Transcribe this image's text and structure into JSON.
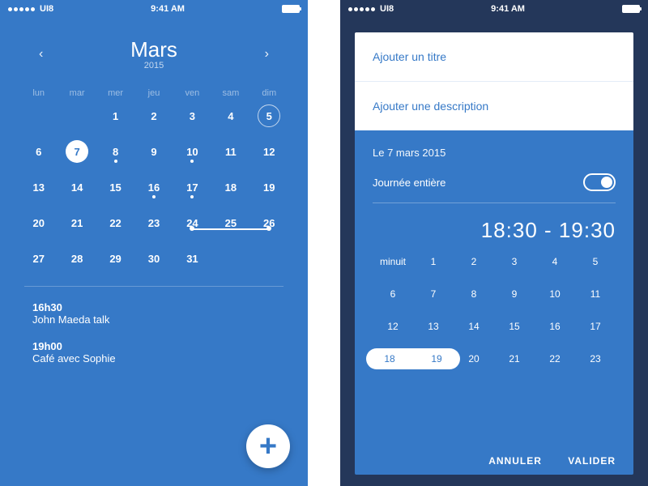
{
  "status": {
    "carrier": "UI8",
    "time": "9:41 AM"
  },
  "left": {
    "month": "Mars",
    "year": "2015",
    "weekdays": [
      "lun",
      "mar",
      "mer",
      "jeu",
      "ven",
      "sam",
      "dim"
    ],
    "days": [
      {
        "n": "",
        "dot": false
      },
      {
        "n": "",
        "dot": false
      },
      {
        "n": "1",
        "dot": false
      },
      {
        "n": "2",
        "dot": false
      },
      {
        "n": "3",
        "dot": false
      },
      {
        "n": "4",
        "dot": false
      },
      {
        "n": "5",
        "dot": false,
        "circled": true
      },
      {
        "n": "6",
        "dot": false
      },
      {
        "n": "7",
        "dot": true,
        "selected": true
      },
      {
        "n": "8",
        "dot": true
      },
      {
        "n": "9",
        "dot": false
      },
      {
        "n": "10",
        "dot": true
      },
      {
        "n": "11",
        "dot": false
      },
      {
        "n": "12",
        "dot": false
      },
      {
        "n": "13",
        "dot": false
      },
      {
        "n": "14",
        "dot": false
      },
      {
        "n": "15",
        "dot": false
      },
      {
        "n": "16",
        "dot": true
      },
      {
        "n": "17",
        "dot": true
      },
      {
        "n": "18",
        "dot": false
      },
      {
        "n": "19",
        "dot": false
      },
      {
        "n": "20",
        "dot": false
      },
      {
        "n": "21",
        "dot": false
      },
      {
        "n": "22",
        "dot": false
      },
      {
        "n": "23",
        "dot": false
      },
      {
        "n": "24",
        "dot": false,
        "rangeStart": true
      },
      {
        "n": "25",
        "dot": false
      },
      {
        "n": "26",
        "dot": false,
        "rangeEnd": true
      },
      {
        "n": "27",
        "dot": false
      },
      {
        "n": "28",
        "dot": false
      },
      {
        "n": "29",
        "dot": false
      },
      {
        "n": "30",
        "dot": false
      },
      {
        "n": "31",
        "dot": false
      }
    ],
    "events": [
      {
        "time": "16h30",
        "title": "John Maeda talk"
      },
      {
        "time": "19h00",
        "title": "Café avec Sophie"
      }
    ]
  },
  "right": {
    "title_placeholder": "Ajouter un titre",
    "desc_placeholder": "Ajouter une description",
    "date_line": "Le 7 mars 2015",
    "allday_label": "Journée entière",
    "time_range": "18:30 - 19:30",
    "hours": [
      "minuit",
      "1",
      "2",
      "3",
      "4",
      "5",
      "6",
      "7",
      "8",
      "9",
      "10",
      "11",
      "12",
      "13",
      "14",
      "15",
      "16",
      "17",
      "18",
      "19",
      "20",
      "21",
      "22",
      "23"
    ],
    "selected_hours": [
      "18",
      "19"
    ],
    "actions": {
      "cancel": "ANNULER",
      "confirm": "VALIDER"
    }
  }
}
